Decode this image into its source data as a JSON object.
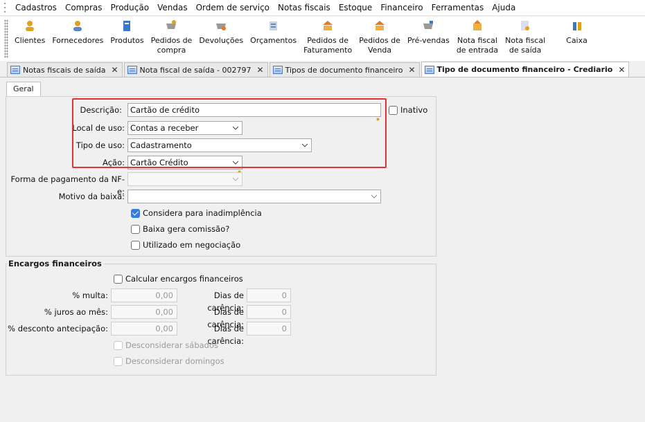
{
  "menu": [
    "Cadastros",
    "Compras",
    "Produção",
    "Vendas",
    "Ordem de serviço",
    "Notas fiscais",
    "Estoque",
    "Financeiro",
    "Ferramentas",
    "Ajuda"
  ],
  "toolbar": [
    {
      "label": "Clientes",
      "icon": "clients-icon",
      "color": "#e0a020"
    },
    {
      "label": "Fornecedores",
      "icon": "suppliers-icon",
      "color": "#e0a020"
    },
    {
      "label": "Produtos",
      "icon": "products-icon",
      "color": "#3a78c8"
    },
    {
      "label": "Pedidos de\ncompra",
      "icon": "purchase-orders-icon",
      "color": "#888888"
    },
    {
      "label": "Devoluções",
      "icon": "returns-icon",
      "color": "#888888"
    },
    {
      "label": "Orçamentos",
      "icon": "quotes-icon",
      "color": "#6a8ab8"
    },
    {
      "label": "Pedidos de\nFaturamento",
      "icon": "billing-orders-icon",
      "color": "#e67a20"
    },
    {
      "label": "Pedidos de\nVenda",
      "icon": "sales-orders-icon",
      "color": "#e67a20"
    },
    {
      "label": "Pré-vendas",
      "icon": "pre-sales-icon",
      "color": "#888888"
    },
    {
      "label": "Nota fiscal\nde entrada",
      "icon": "invoice-in-icon",
      "color": "#e67a20"
    },
    {
      "label": "Nota fiscal\nde saída",
      "icon": "invoice-out-icon",
      "color": "#6a8ab8"
    },
    {
      "label": "Caixa",
      "icon": "cash-icon",
      "color": "#3a78c8"
    }
  ],
  "tabs": [
    {
      "label": "Notas fiscais de saída",
      "active": false
    },
    {
      "label": "Nota fiscal de saída - 002797",
      "active": false
    },
    {
      "label": "Tipos de documento financeiro",
      "active": false
    },
    {
      "label": "Tipo de documento financeiro - Crediario",
      "active": true
    }
  ],
  "subtab": "Geral",
  "form": {
    "descricao_label": "Descrição:",
    "descricao_value": "Cartão de crédito",
    "inativo_label": "Inativo",
    "local_label": "Local de uso:",
    "local_value": "Contas a receber",
    "tipo_label": "Tipo de uso:",
    "tipo_value": "Cadastramento",
    "acao_label": "Ação:",
    "acao_value": "Cartão Crédito",
    "forma_label": "Forma de pagamento da NF-e:",
    "forma_value": "",
    "motivo_label": "Motivo da baixa:",
    "motivo_value": "",
    "considera_label": "Considera para inadimplência",
    "considera_checked": true,
    "baixa_label": "Baixa gera comissão?",
    "utilizado_label": "Utilizado em negociação"
  },
  "encargos": {
    "title": "Encargos financeiros",
    "calcular_label": "Calcular encargos financeiros",
    "multa_label": "% multa:",
    "multa_value": "0,00",
    "juros_label": "% juros ao mês:",
    "juros_value": "0,00",
    "desconto_label": "% desconto antecipação:",
    "desconto_value": "0,00",
    "carencia_label": "Dias de carência:",
    "carencia1": "0",
    "carencia2": "0",
    "carencia3": "0",
    "sabados_label": "Desconsiderar sábados",
    "domingos_label": "Desconsiderar domingos"
  },
  "colors": {
    "highlight": "#e53030",
    "checked": "#2f7de1"
  }
}
